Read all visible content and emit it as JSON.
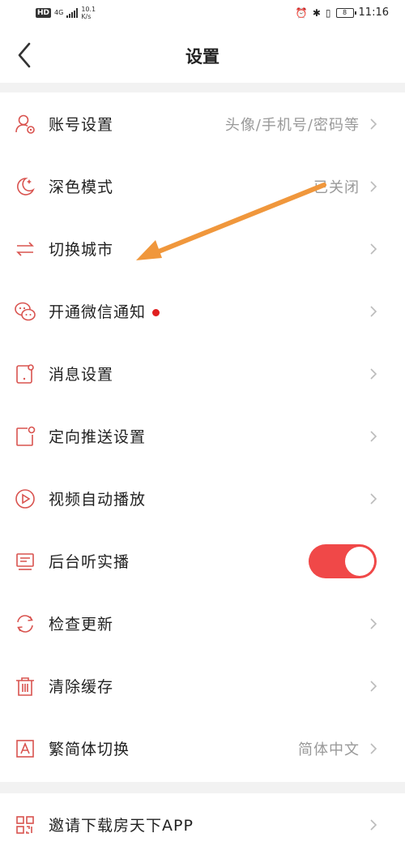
{
  "status_bar": {
    "network": "4G",
    "speed_value": "10.1",
    "speed_unit": "K/s",
    "time": "11:16",
    "battery": "8"
  },
  "header": {
    "title": "设置"
  },
  "colors": {
    "accent": "#d9534f",
    "toggle_on": "#f04848",
    "arrow": "#f0973c"
  },
  "settings": [
    {
      "label": "账号设置",
      "value": "头像/手机号/密码等",
      "icon": "user-settings-icon"
    },
    {
      "label": "深色模式",
      "value": "已关闭",
      "icon": "moon-icon"
    },
    {
      "label": "切换城市",
      "value": "",
      "icon": "switch-arrows-icon"
    },
    {
      "label": "开通微信通知",
      "value": "",
      "icon": "wechat-icon"
    },
    {
      "label": "消息设置",
      "value": "",
      "icon": "message-icon"
    },
    {
      "label": "定向推送设置",
      "value": "",
      "icon": "push-icon"
    },
    {
      "label": "视频自动播放",
      "value": "",
      "icon": "play-icon"
    },
    {
      "label": "后台听实播",
      "value": "",
      "icon": "radio-icon",
      "toggle_on": true
    },
    {
      "label": "检查更新",
      "value": "",
      "icon": "refresh-icon"
    },
    {
      "label": "清除缓存",
      "value": "",
      "icon": "trash-icon"
    },
    {
      "label": "繁简体切换",
      "value": "简体中文",
      "icon": "font-a-icon"
    }
  ],
  "invite": {
    "label": "邀请下载房天下APP",
    "icon": "qr-code-icon"
  }
}
